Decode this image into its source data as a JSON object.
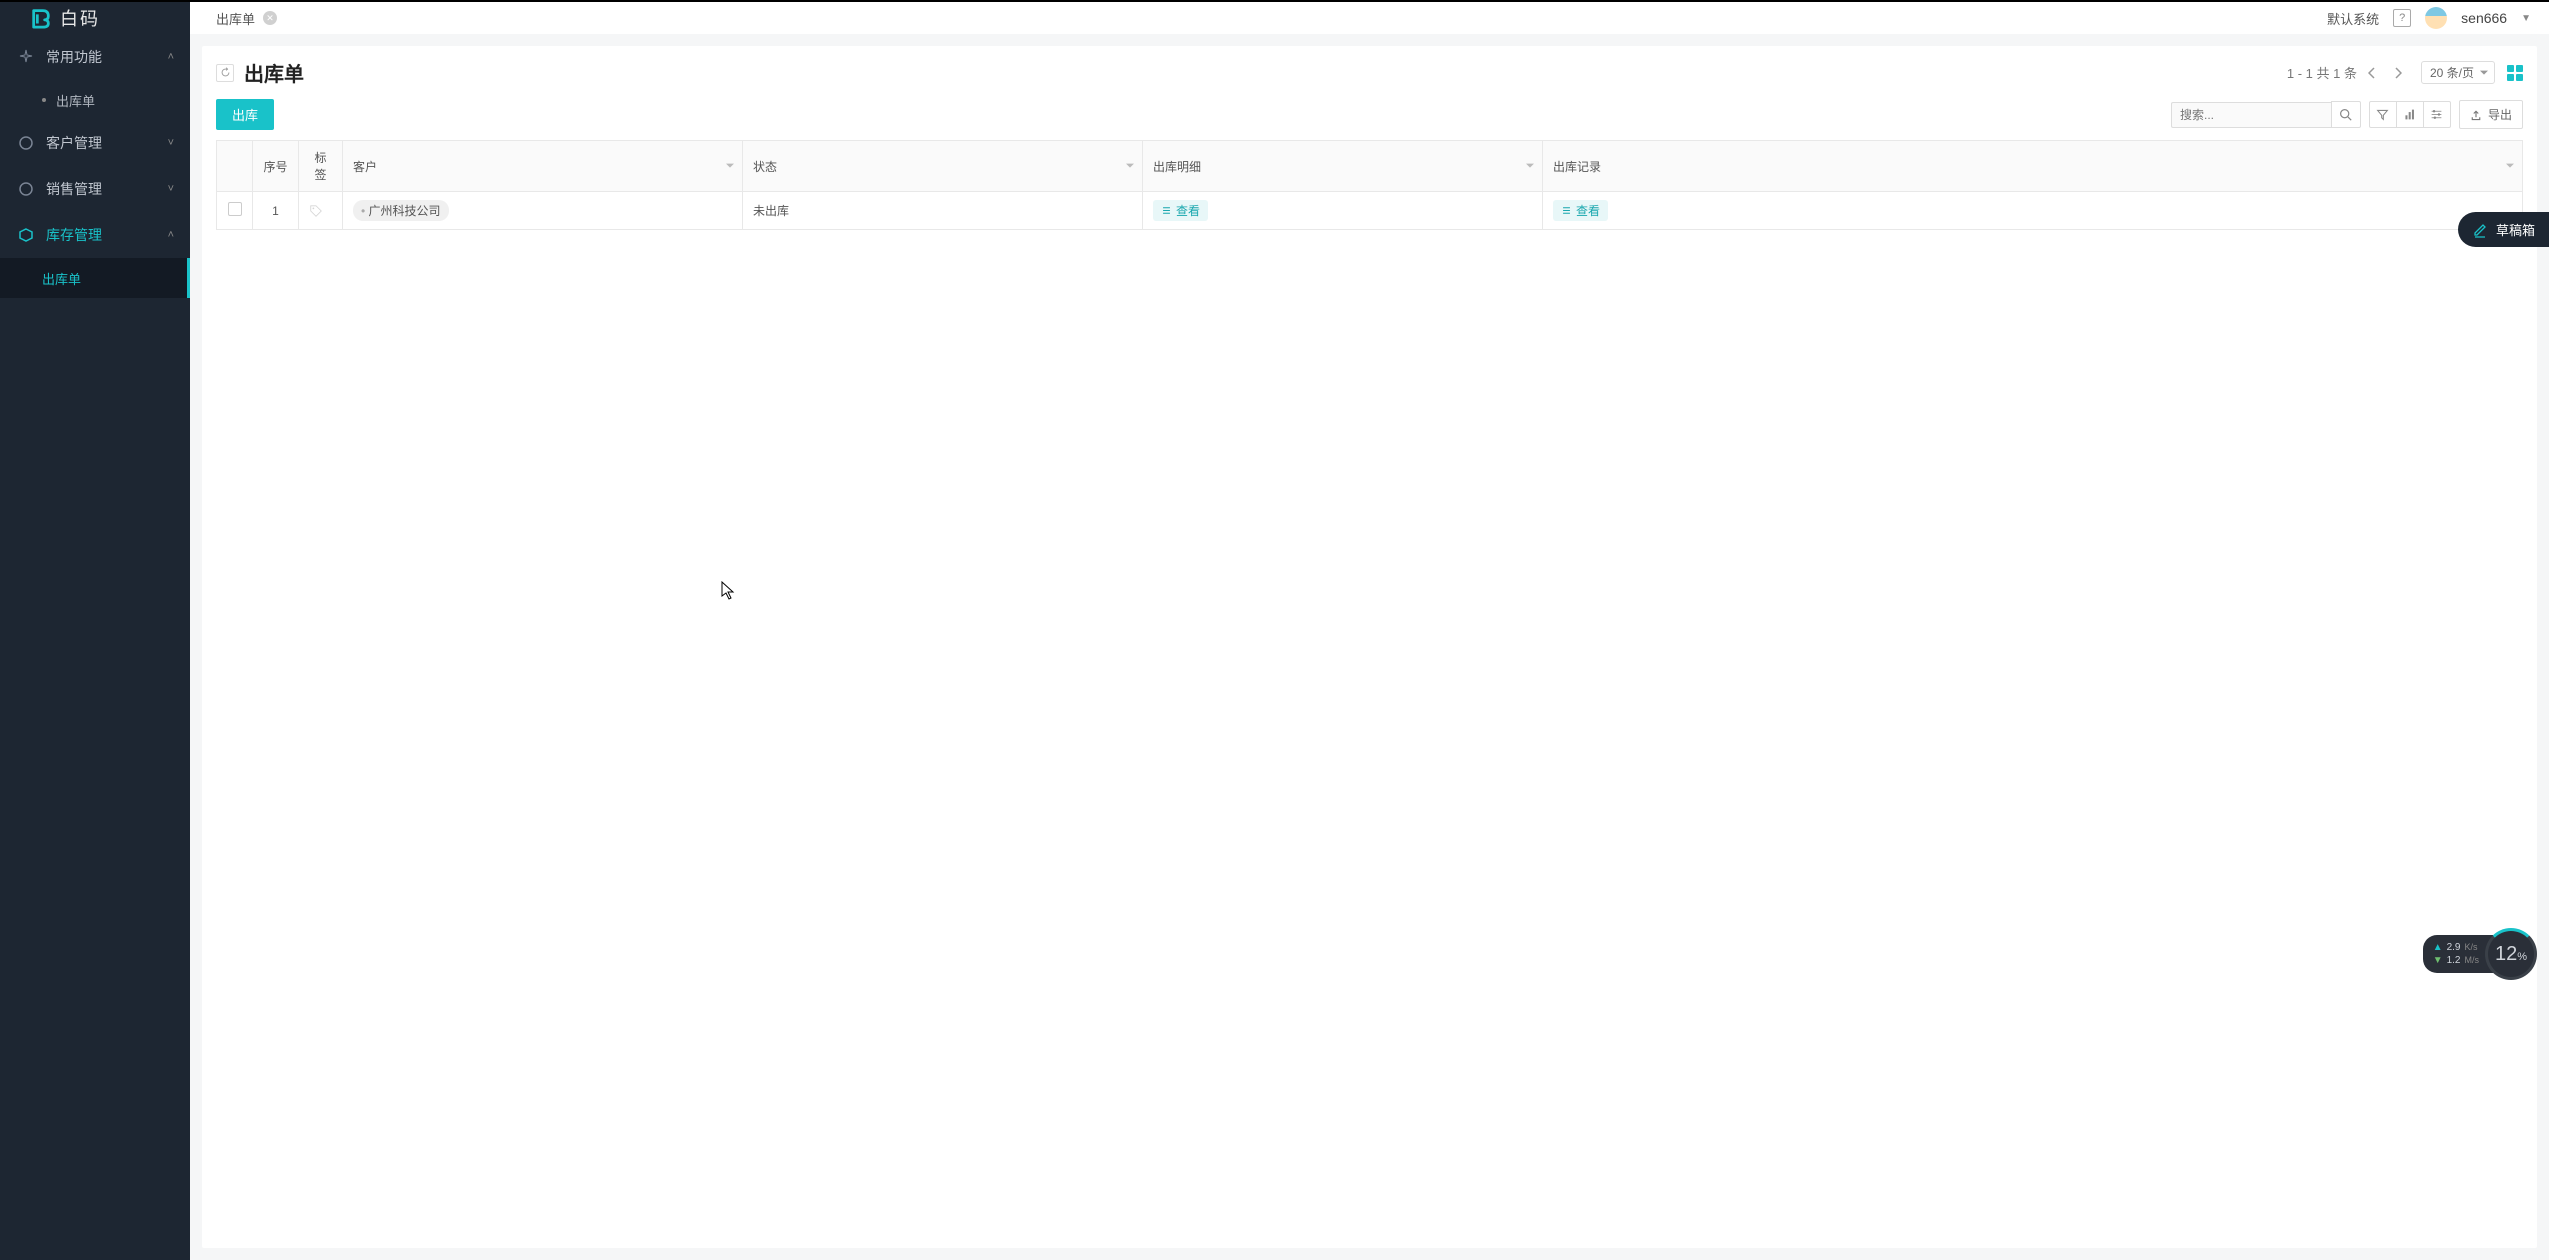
{
  "brand": {
    "name": "白码"
  },
  "topbar": {
    "tab_label": "出库单",
    "system": "默认系统",
    "username": "sen666"
  },
  "sidebar": {
    "items": [
      {
        "label": "常用功能",
        "expanded": true,
        "children": [
          {
            "label": "出库单"
          }
        ]
      },
      {
        "label": "客户管理",
        "expanded": false
      },
      {
        "label": "销售管理",
        "expanded": false
      },
      {
        "label": "库存管理",
        "expanded": true,
        "active": true,
        "children": [
          {
            "label": "出库单",
            "selected": true
          }
        ]
      }
    ]
  },
  "page": {
    "title": "出库单",
    "primary_action": "出库",
    "pagination_text": "1 - 1  共  1  条",
    "page_size_label": "20 条/页",
    "search_placeholder": "搜索...",
    "export_label": "导出"
  },
  "table": {
    "columns": {
      "seq": "序号",
      "tag": "标签",
      "customer": "客户",
      "status": "状态",
      "detail": "出库明细",
      "record": "出库记录"
    },
    "rows": [
      {
        "seq": "1",
        "customer": "广州科技公司",
        "status": "未出库",
        "detail_action": "查看",
        "record_action": "查看"
      }
    ]
  },
  "draft_box": {
    "label": "草稿箱"
  },
  "net_widget": {
    "up_value": "2.9",
    "up_unit": "K/s",
    "down_value": "1.2",
    "down_unit": "M/s",
    "percent": "12",
    "percent_unit": "%"
  }
}
